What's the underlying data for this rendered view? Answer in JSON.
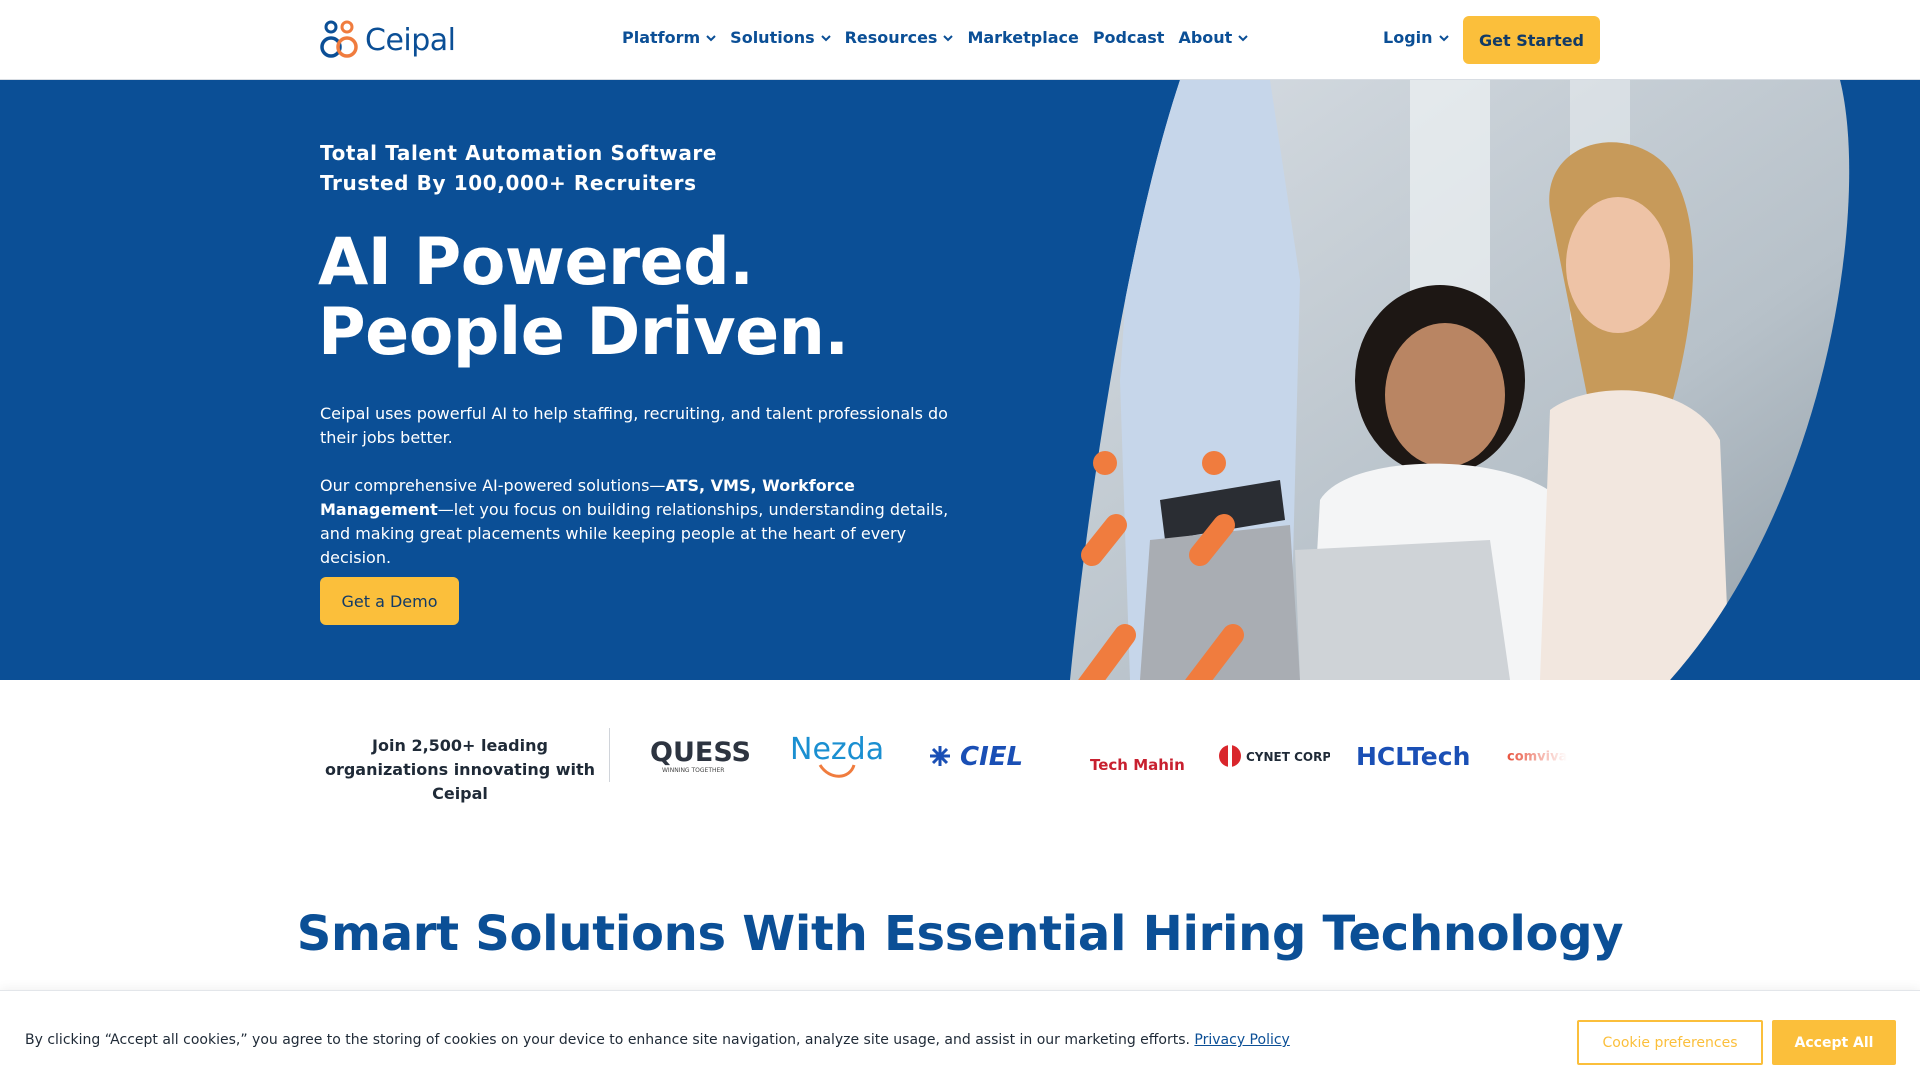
{
  "brand": {
    "name": "Ceipal",
    "logo_icon": "ceipal-rings-logo"
  },
  "nav": {
    "items": [
      {
        "label": "Platform",
        "has_dropdown": true
      },
      {
        "label": "Solutions",
        "has_dropdown": true
      },
      {
        "label": "Resources",
        "has_dropdown": true
      },
      {
        "label": "Marketplace",
        "has_dropdown": false
      },
      {
        "label": "Podcast",
        "has_dropdown": false
      },
      {
        "label": "About",
        "has_dropdown": true
      }
    ],
    "login_label": "Login",
    "cta_label": "Get Started"
  },
  "hero": {
    "eyebrow_line1": "Total Talent Automation Software",
    "eyebrow_line2": "Trusted By 100,000+ Recruiters",
    "headline_line1": "AI Powered.",
    "headline_line2": "People Driven.",
    "para1": "Ceipal uses powerful AI to help staffing, recruiting, and talent professionals do their jobs better.",
    "para2_prefix": "Our comprehensive AI-powered solutions—",
    "para2_bold": "ATS, VMS, Workforce Management",
    "para2_suffix": "—let you focus on building relationships, understanding details, and making great placements while keeping people at the heart of every decision.",
    "cta_label": "Get a Demo",
    "image_icon": "office-team-photo"
  },
  "clients": {
    "intro": "Join 2,500+ leading organizations innovating with Ceipal",
    "logos": [
      {
        "name": "QUESS",
        "tagline": "WINNING TOGETHER"
      },
      {
        "name": "Nezda"
      },
      {
        "name": "CIEL"
      },
      {
        "name": "Tech Mahindra"
      },
      {
        "name": "CYNET CORP"
      },
      {
        "name": "HCLTech"
      },
      {
        "name": "comviva"
      }
    ]
  },
  "section": {
    "title": "Smart Solutions With Essential Hiring Technology"
  },
  "cookie": {
    "text": "By clicking “Accept all cookies,” you agree to the storing of cookies on your device to enhance site navigation, analyze site usage, and assist in our marketing efforts.",
    "link_label": "Privacy Policy",
    "preferences_label": "Cookie preferences",
    "accept_label": "Accept All"
  },
  "colors": {
    "primary_blue": "#0b4f96",
    "accent_yellow": "#fbbf3b",
    "accent_orange": "#f07c3e"
  }
}
